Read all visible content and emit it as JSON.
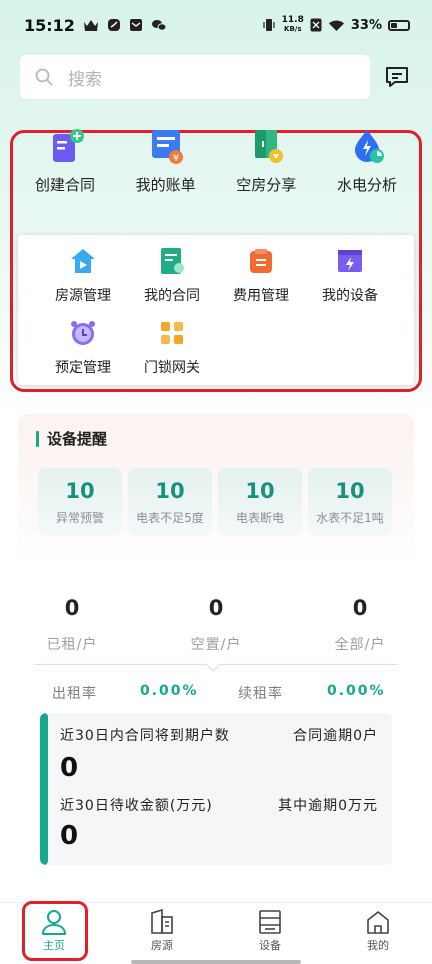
{
  "status": {
    "time": "15:12",
    "net_speed": "11.8",
    "net_unit": "KB/s",
    "battery": "33%"
  },
  "search": {
    "placeholder": "搜索"
  },
  "top_actions": [
    {
      "label": "创建合同",
      "icon": "create-contract-icon"
    },
    {
      "label": "我的账单",
      "icon": "bill-icon"
    },
    {
      "label": "空房分享",
      "icon": "vacant-share-icon"
    },
    {
      "label": "水电分析",
      "icon": "utility-analysis-icon"
    }
  ],
  "grid_items": [
    {
      "label": "房源管理",
      "icon": "house-icon"
    },
    {
      "label": "我的合同",
      "icon": "contract-icon"
    },
    {
      "label": "费用管理",
      "icon": "fee-icon"
    },
    {
      "label": "我的设备",
      "icon": "device-icon"
    },
    {
      "label": "预定管理",
      "icon": "alarm-clock-icon"
    },
    {
      "label": "门锁网关",
      "icon": "gateway-icon"
    }
  ],
  "device_alerts": {
    "title": "设备提醒",
    "items": [
      {
        "value": "10",
        "label": "异常预警"
      },
      {
        "value": "10",
        "label": "电表不足5度"
      },
      {
        "value": "10",
        "label": "电表断电"
      },
      {
        "value": "10",
        "label": "水表不足1吨"
      }
    ]
  },
  "stats": [
    {
      "value": "0",
      "label": "已租/户"
    },
    {
      "value": "0",
      "label": "空置/户"
    },
    {
      "value": "0",
      "label": "全部/户"
    }
  ],
  "rates": {
    "occupancy_label": "出租率",
    "occupancy_value": "0.00%",
    "renewal_label": "续租率",
    "renewal_value": "0.00%"
  },
  "summary": {
    "expiring_label": "近30日内合同将到期户数",
    "overdue_label": "合同逾期0户",
    "expiring_value": "0",
    "receivable_label": "近30日待收金额(万元)",
    "overdue_amount_label": "其中逾期0万元",
    "receivable_value": "0"
  },
  "tabs": [
    {
      "label": "主页",
      "icon": "home-icon",
      "active": true
    },
    {
      "label": "房源",
      "icon": "building-icon",
      "active": false
    },
    {
      "label": "设备",
      "icon": "device-tab-icon",
      "active": false
    },
    {
      "label": "我的",
      "icon": "profile-house-icon",
      "active": false
    }
  ],
  "colors": {
    "accent": "#17a98a",
    "highlight_frame": "#e0202c"
  }
}
